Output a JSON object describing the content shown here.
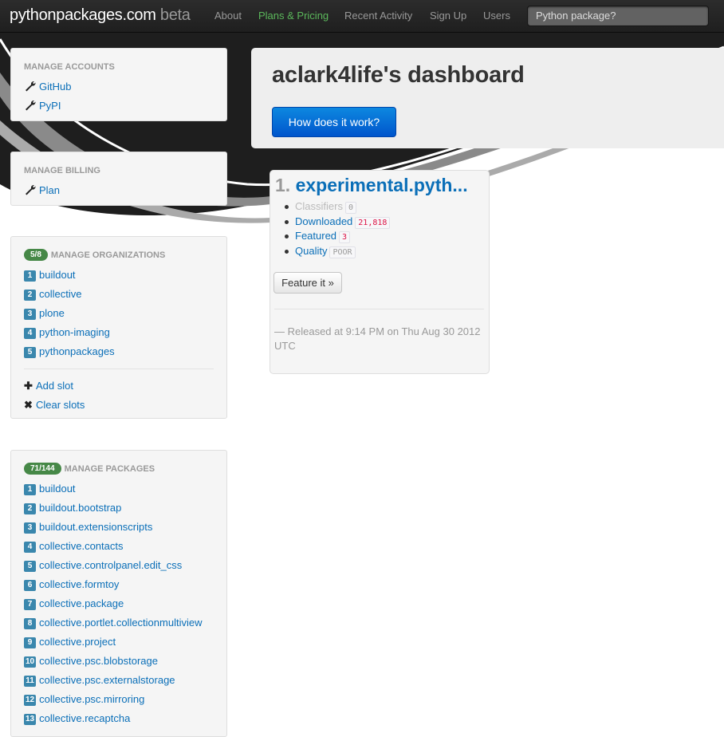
{
  "navbar": {
    "brand": "pythonpackages.com",
    "brand_suffix": "beta",
    "links": [
      "About",
      "Plans & Pricing",
      "Recent Activity",
      "Sign Up",
      "Users"
    ],
    "active_link": "Plans & Pricing",
    "search_placeholder": "Python package?"
  },
  "accounts": {
    "header": "MANAGE ACCOUNTS",
    "items": [
      "GitHub",
      "PyPI"
    ]
  },
  "billing": {
    "header": "MANAGE BILLING",
    "items": [
      "Plan"
    ]
  },
  "organizations": {
    "badge": "5/8",
    "header": "MANAGE ORGANIZATIONS",
    "items": [
      {
        "n": "1",
        "name": "buildout"
      },
      {
        "n": "2",
        "name": "collective"
      },
      {
        "n": "3",
        "name": "plone"
      },
      {
        "n": "4",
        "name": "python-imaging"
      },
      {
        "n": "5",
        "name": "pythonpackages"
      }
    ],
    "add_slot": "Add slot",
    "clear_slots": "Clear slots"
  },
  "packages": {
    "badge": "71/144",
    "header": "MANAGE PACKAGES",
    "items": [
      {
        "n": "1",
        "name": "buildout"
      },
      {
        "n": "2",
        "name": "buildout.bootstrap"
      },
      {
        "n": "3",
        "name": "buildout.extensionscripts"
      },
      {
        "n": "4",
        "name": "collective.contacts"
      },
      {
        "n": "5",
        "name": "collective.controlpanel.edit_css"
      },
      {
        "n": "6",
        "name": "collective.formtoy"
      },
      {
        "n": "7",
        "name": "collective.package"
      },
      {
        "n": "8",
        "name": "collective.portlet.collectionmultiview"
      },
      {
        "n": "9",
        "name": "collective.project"
      },
      {
        "n": "10",
        "name": "collective.psc.blobstorage"
      },
      {
        "n": "11",
        "name": "collective.psc.externalstorage"
      },
      {
        "n": "12",
        "name": "collective.psc.mirroring"
      },
      {
        "n": "13",
        "name": "collective.recaptcha"
      }
    ]
  },
  "hero": {
    "title": "aclark4life's dashboard",
    "button": "How does it work?"
  },
  "package_card": {
    "index": "1.",
    "title": "experimental.pyth...",
    "stats": [
      {
        "label": "Classifiers",
        "value": "0"
      },
      {
        "label": "Downloaded",
        "value": "21,818"
      },
      {
        "label": "Featured",
        "value": "3"
      },
      {
        "label": "Quality",
        "value": "POOR"
      }
    ],
    "feature_button": "Feature it »",
    "released": "— Released at 9:14 PM on Thu Aug 30 2012 UTC"
  },
  "colors": {
    "navbar_bg": "#222222",
    "link": "#0b6fb8",
    "active_nav": "#5bb75b",
    "badge_green": "#468847",
    "number_badge": "#3a87ad",
    "primary_button": "#0066dd"
  }
}
